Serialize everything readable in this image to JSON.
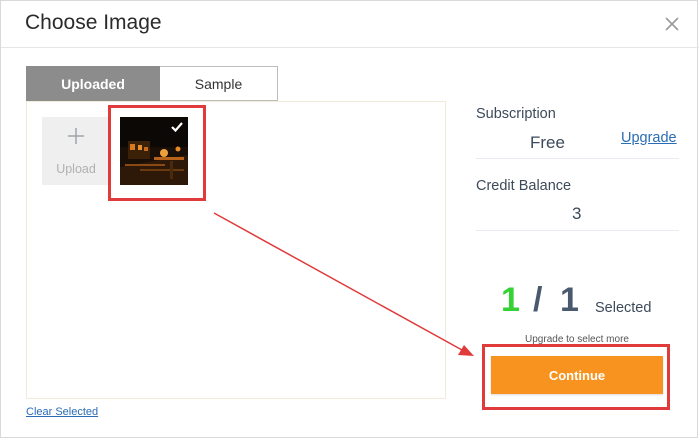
{
  "dialog": {
    "title": "Choose Image",
    "close_icon": "close-icon"
  },
  "tabs": [
    {
      "label": "Uploaded",
      "active": true
    },
    {
      "label": "Sample",
      "active": false
    }
  ],
  "gallery": {
    "upload_label": "Upload",
    "upload_icon": "plus-icon",
    "selected_image": {
      "selected": true,
      "check_icon": "checkmark-icon"
    }
  },
  "footer": {
    "clear_label": "Clear Selected"
  },
  "sidebar": {
    "subscription_label": "Subscription",
    "subscription_value": "Free",
    "upgrade_label": "Upgrade",
    "credit_label": "Credit Balance",
    "credit_value": "3",
    "selected_count": "1",
    "separator": "/",
    "selected_max": "1",
    "selected_label": "Selected",
    "upgrade_note": "Upgrade to select more",
    "continue_label": "Continue"
  },
  "colors": {
    "accent": "#f7931e",
    "selected_count": "#35d135",
    "max_count": "#4a5a6e",
    "link": "#2a6db4",
    "highlight": "#e03a3a",
    "active_tab": "#8c8c8c"
  }
}
